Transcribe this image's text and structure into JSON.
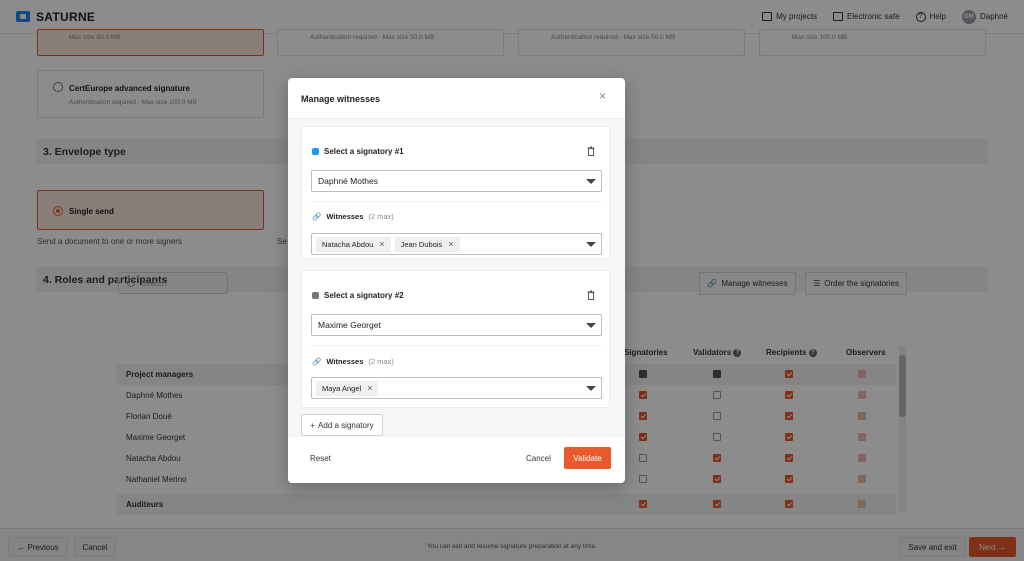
{
  "topbar": {
    "app_name": "SATURNE",
    "my_projects": "My projects",
    "electronic_safe": "Electronic safe",
    "help": "Help",
    "avatar_initials": "DM",
    "user_name": "Daphné"
  },
  "signature_types": {
    "card1_sub": "Max size 50.0 MB",
    "card2_sub": "Authentication required · Max size 50.0 MB",
    "card3_sub": "Authentication required · Max size 50.0 MB",
    "card4_sub": "Max size 100.0 MB",
    "certeurope_title": "CertEurope advanced signature",
    "certeurope_sub": "Authentication required · Max size 100.0 MB"
  },
  "envelope": {
    "section_title": "3. Envelope type",
    "single_send": "Single send",
    "single_send_desc": "Send a document to one or more signers",
    "other_desc_fragment": "Se"
  },
  "roles": {
    "section_title": "4. Roles and participants",
    "search_placeholder": "Search",
    "manage_witnesses": "Manage witnesses",
    "order_signatories": "Order the signatories",
    "columns": {
      "signatories": "Signatories",
      "validators": "Validators",
      "recipients": "Recipients",
      "observers": "Observers"
    },
    "group1": "Project managers",
    "people": [
      "Daphné Mothes",
      "Florian Doué",
      "Maxime Georget",
      "Natacha Abdou",
      "Nathaniel Merino"
    ],
    "group2": "Auditeurs"
  },
  "footer": {
    "previous": "Previous",
    "cancel": "Cancel",
    "message": "You can exit and resume signature preparation at any time.",
    "save_exit": "Save and exit",
    "next": "Next"
  },
  "modal": {
    "title": "Manage witnesses",
    "close": "×",
    "sig1": {
      "label": "Select a signatory #1",
      "color": "#1e9ee8",
      "selected": "Daphné Mothes",
      "witnesses_label": "Witnesses",
      "witnesses_max": "(2 max)",
      "chips": [
        "Natacha Abdou",
        "Jean Dubois"
      ]
    },
    "sig2": {
      "label": "Select a signatory #2",
      "color": "#777777",
      "selected": "Maxime Georget",
      "witnesses_label": "Witnesses",
      "witnesses_max": "(2 max)",
      "chips": [
        "Maya Angel"
      ]
    },
    "add_signatory": "Add a signatory",
    "reset": "Reset",
    "cancel": "Cancel",
    "validate": "Validate"
  },
  "colors": {
    "accent": "#e85a2c",
    "sig1_dot": "#1e9ee8",
    "sig2_dot": "#777777"
  }
}
